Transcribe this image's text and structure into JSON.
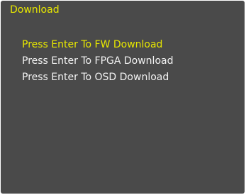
{
  "title": "Download",
  "menu": {
    "items": [
      {
        "label": "Press Enter To FW Download",
        "selected": true
      },
      {
        "label": "Press Enter To FPGA Download",
        "selected": false
      },
      {
        "label": "Press Enter To OSD Download",
        "selected": false
      }
    ]
  },
  "colors": {
    "background": "#4a4a4a",
    "highlight": "#e8e800",
    "text": "#f2f2f2"
  }
}
